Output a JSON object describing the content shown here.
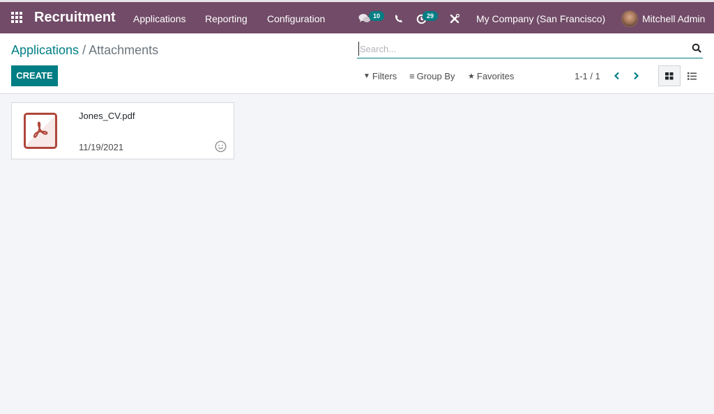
{
  "navbar": {
    "app_name": "Recruitment",
    "menu": [
      {
        "label": "Applications"
      },
      {
        "label": "Reporting"
      },
      {
        "label": "Configuration"
      }
    ],
    "messages_count": "10",
    "activities_count": "29",
    "company": "My Company (San Francisco)",
    "user": "Mitchell Admin",
    "icons": {
      "apps": "apps-grid-icon",
      "messages": "chat-bubbles-icon",
      "phone": "phone-icon",
      "activities": "clock-icon",
      "debug": "tools-icon"
    }
  },
  "control_panel": {
    "breadcrumb": {
      "parent": "Applications",
      "separator": " / ",
      "current": "Attachments"
    },
    "create_label": "CREATE",
    "search_placeholder": "Search...",
    "search_value": "",
    "filters_label": "Filters",
    "group_by_label": "Group By",
    "favorites_label": "Favorites",
    "pager": "1-1 / 1",
    "active_view": "kanban"
  },
  "kanban": {
    "records": [
      {
        "name": "Jones_CV.pdf",
        "date": "11/19/2021",
        "file_type": "pdf"
      }
    ]
  },
  "colors": {
    "navbar": "#714b67",
    "primary": "#017e84",
    "pdf_red": "#b0463a"
  }
}
